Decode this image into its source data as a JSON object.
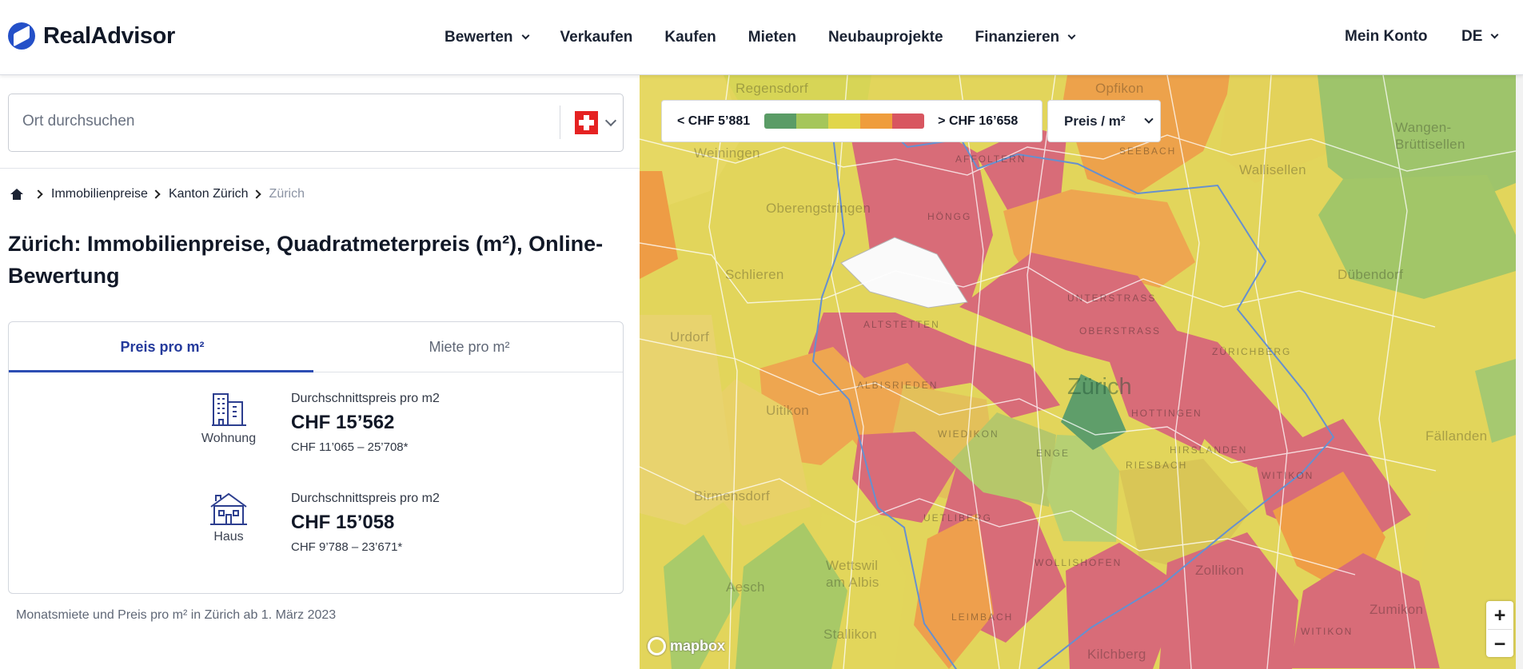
{
  "brand": {
    "name": "RealAdvisor",
    "primary_color": "#2450c8"
  },
  "navigation": {
    "items": [
      "Bewerten",
      "Verkaufen",
      "Kaufen",
      "Mieten",
      "Neubauprojekte",
      "Finanzieren"
    ],
    "account": "Mein Konto",
    "language": "DE"
  },
  "search": {
    "placeholder": "Ort durchsuchen",
    "country_flag": "Swiss flag"
  },
  "breadcrumb": {
    "items": [
      "Immobilienpreise",
      "Kanton Zürich",
      "Zürich"
    ]
  },
  "page": {
    "title": "Zürich: Immobilienpreise, Quadratmeterpreis (m²), Online-Bewertung"
  },
  "price_card": {
    "tabs": [
      {
        "label": "Preis pro m²",
        "active": true
      },
      {
        "label": "Miete pro m²",
        "active": false
      }
    ],
    "properties": [
      {
        "type": "Wohnung",
        "caption": "Durchschnittspreis pro m2",
        "value": "CHF 15’562",
        "range": "CHF 11’065 – 25’708*",
        "icon": "apartment-building-icon"
      },
      {
        "type": "Haus",
        "caption": "Durchschnittspreis pro m2",
        "value": "CHF 15’058",
        "range": "CHF 9’788 – 23’671*",
        "icon": "house-icon"
      }
    ]
  },
  "footnote": "Monatsmiete und Preis pro m² in Zürich ab 1. März 2023",
  "map": {
    "legend": {
      "min": "< CHF 5’881",
      "max": "> CHF 16’658",
      "colors": [
        "#5a9c66",
        "#a5c65a",
        "#e1d64a",
        "#ef9d3c",
        "#d85660"
      ]
    },
    "metric_select": "Preis / m²",
    "labels": [
      "Regensdorf",
      "Opfikon",
      "Weiningen",
      "Wangen-Brüttisellen",
      "Wallisellen",
      "Oberengstringen",
      "Schlieren",
      "Dübendorf",
      "Urdorf",
      "Zürich",
      "Uitikon",
      "Fällanden",
      "Birmensdorf",
      "Aesch",
      "Wettswil am Albis",
      "Zollikon",
      "Zumikon",
      "Stallikon",
      "Kilchberg"
    ],
    "districts": [
      "Affoltern",
      "Seebach",
      "Höngg",
      "Altstetten",
      "Unterstrass",
      "Oberstrass",
      "Zürichberg",
      "Albisrieden",
      "Hottingen",
      "Wiedikon",
      "Hirslanden",
      "Witikon",
      "Enge",
      "Riesbach",
      "Wollishofen",
      "Leimbach",
      "Uetliberg",
      "Witikon"
    ],
    "attribution": "mapbox"
  }
}
